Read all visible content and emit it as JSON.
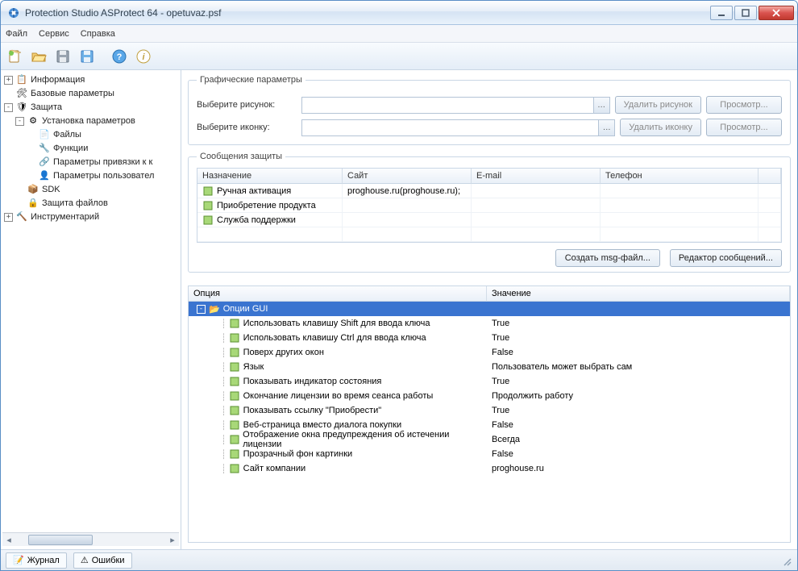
{
  "window": {
    "title": "Protection Studio ASProtect 64 - opetuvaz.psf"
  },
  "menu": {
    "file": "Файл",
    "service": "Сервис",
    "help": "Справка"
  },
  "tree": {
    "n0": "Информация",
    "n1": "Базовые параметры",
    "n2": "Защита",
    "n3": "Установка параметров",
    "n4": "Файлы",
    "n5": "Функции",
    "n6": "Параметры привязки к к",
    "n7": "Параметры пользовател",
    "n8": "SDK",
    "n9": "Защита файлов",
    "n10": "Инструментарий"
  },
  "graphics": {
    "legend": "Графические параметры",
    "picLabel": "Выберите рисунок:",
    "iconLabel": "Выберите иконку:",
    "deletePic": "Удалить рисунок",
    "deleteIcon": "Удалить иконку",
    "view": "Просмотр..."
  },
  "messages": {
    "legend": "Сообщения защиты",
    "cols": {
      "dest": "Назначение",
      "site": "Сайт",
      "email": "E-mail",
      "phone": "Телефон"
    },
    "r0_dest": "Ручная активация",
    "r0_site": "proghouse.ru(proghouse.ru);",
    "r1_dest": "Приобретение продукта",
    "r2_dest": "Служба поддержки",
    "createMsg": "Создать msg-файл...",
    "editMsg": "Редактор сообщений..."
  },
  "options": {
    "cols": {
      "opt": "Опция",
      "val": "Значение"
    },
    "g0": "Опции GUI",
    "r0n": "Использовать клавишу Shift для ввода ключа",
    "r0v": "True",
    "r1n": "Использовать клавишу Ctrl для ввода ключа",
    "r1v": "True",
    "r2n": "Поверх других окон",
    "r2v": "False",
    "r3n": "Язык",
    "r3v": "Пользователь может выбрать сам",
    "r4n": "Показывать индикатор состояния",
    "r4v": "True",
    "r5n": "Окончание лицензии во время сеанса работы",
    "r5v": "Продолжить работу",
    "r6n": "Показывать ссылку \"Приобрести\"",
    "r6v": "True",
    "r7n": "Веб-страница вместо диалога покупки",
    "r7v": "False",
    "r8n": "Отображение окна предупреждения об истечении лицензии",
    "r8v": "Всегда",
    "r9n": "Прозрачный фон картинки",
    "r9v": "False",
    "r10n": "Сайт компании",
    "r10v": "proghouse.ru"
  },
  "status": {
    "journal": "Журнал",
    "errors": "Ошибки"
  }
}
